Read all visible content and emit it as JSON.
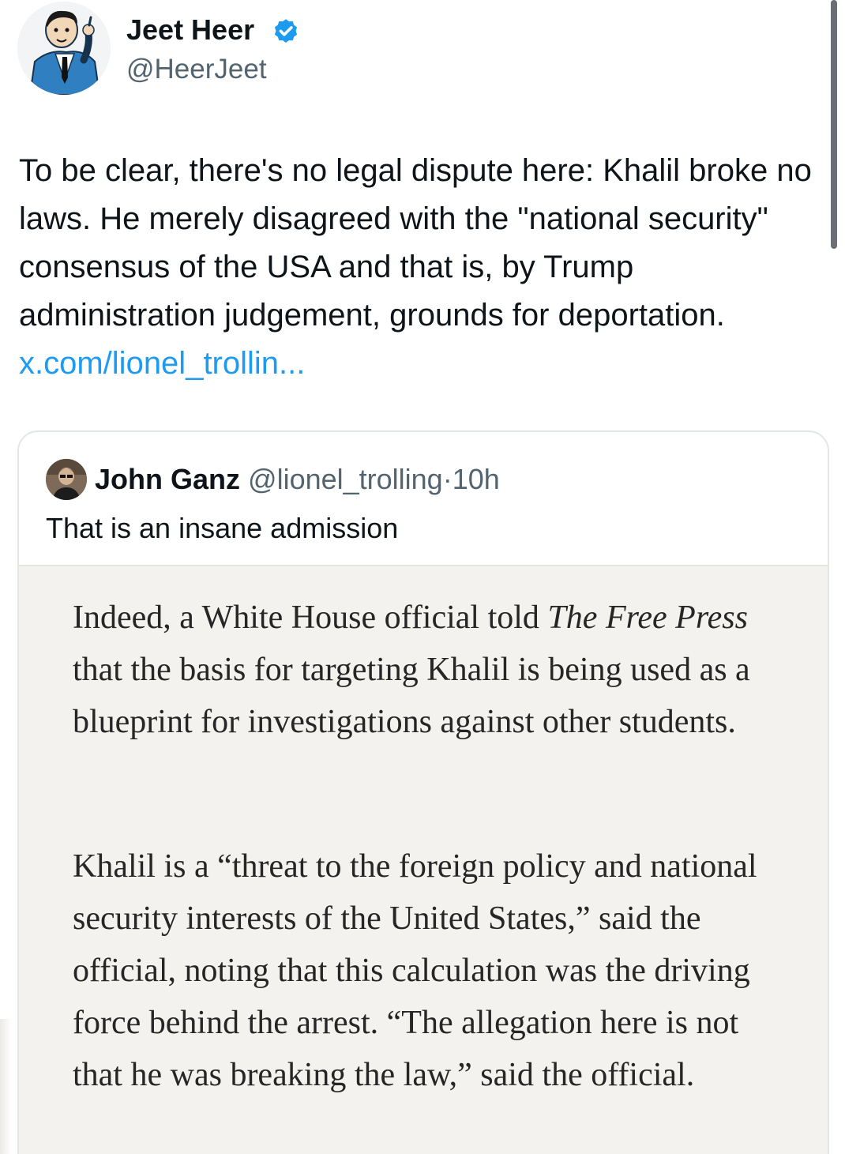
{
  "tweet": {
    "author_name": "Jeet Heer",
    "author_handle": "@HeerJeet",
    "verified_icon": "verified-badge-icon",
    "text": "To be clear, there's no legal dispute here: Khalil broke no laws. He merely disagreed with the \"national security\" consensus of the USA and that is, by Trump administration judgement, grounds for deportation. ",
    "link_text": "x.com/lionel_trollin..."
  },
  "quote": {
    "author_name": "John Ganz",
    "author_handle": "@lionel_trolling",
    "separator": "·",
    "time": "10h",
    "text": "That is an insane admission",
    "excerpt": {
      "p1_before": "Indeed, a White House official told ",
      "p1_italic": "The Free Press",
      "p1_after": " that the basis for targeting Khalil is being used as a blueprint for investigations against other students.",
      "p2": "Khalil is a “threat to the foreign policy and national security interests of the United States,” said the official, noting that this calculation was the driving force behind the arrest. “The allegation here is not that he was breaking the law,” said the official."
    }
  },
  "colors": {
    "link": "#1d9bf0",
    "verified": "#1d9bf0",
    "secondary_text": "#536471",
    "excerpt_bg": "#f4f2ef"
  }
}
